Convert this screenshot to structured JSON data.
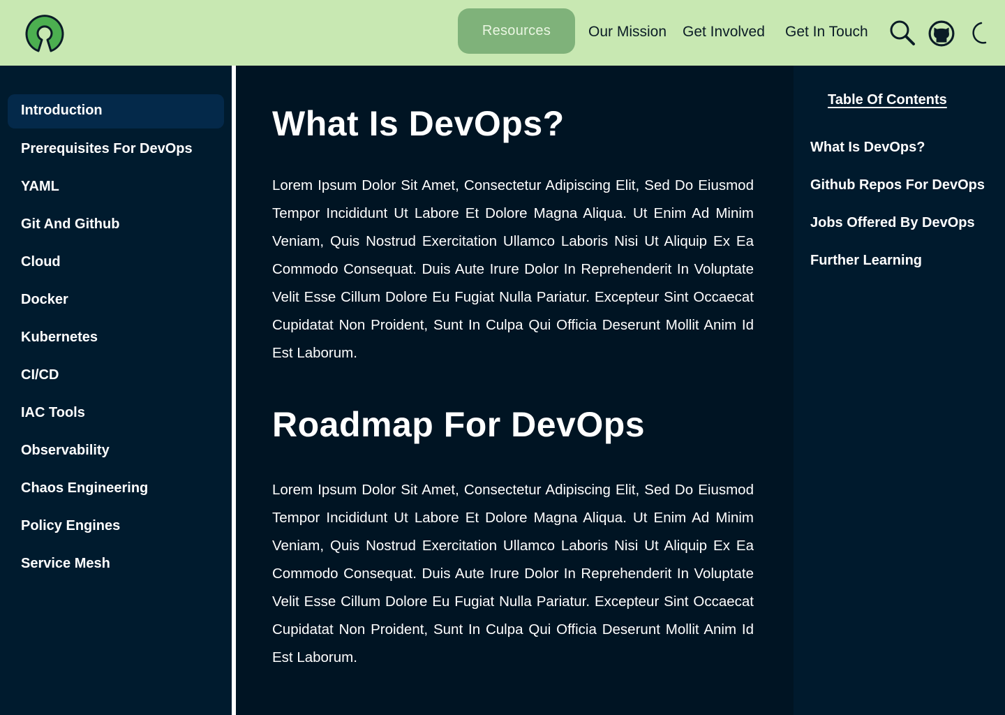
{
  "header": {
    "logo": "open-source-logo",
    "nav": {
      "resources": "Resources",
      "mission": "Our Mission",
      "involved": "Get Involved",
      "touch": "Get In Touch"
    },
    "icons": [
      "search-icon",
      "github-icon",
      "moon-icon"
    ],
    "colors": {
      "bar": "#c8e8b2",
      "active_pill": "#7fb27a"
    }
  },
  "sidebar": {
    "items": [
      "Introduction",
      "Prerequisites For DevOps",
      "YAML",
      "Git And Github",
      "Cloud",
      "Docker",
      "Kubernetes",
      "CI/CD",
      "IAC Tools",
      "Observability",
      "Chaos Engineering",
      "Policy Engines",
      "Service Mesh"
    ],
    "active": "Introduction"
  },
  "content": {
    "sections": [
      {
        "heading": "What Is DevOps?",
        "body": "Lorem Ipsum Dolor Sit Amet, Consectetur Adipiscing Elit, Sed Do Eiusmod Tempor Incididunt Ut Labore Et Dolore Magna Aliqua. Ut Enim Ad Minim Veniam, Quis Nostrud Exercitation Ullamco Laboris Nisi Ut Aliquip Ex Ea Commodo Consequat. Duis Aute Irure Dolor In Reprehenderit In Voluptate Velit Esse Cillum Dolore Eu Fugiat Nulla Pariatur. Excepteur Sint Occaecat Cupidatat Non Proident, Sunt In Culpa Qui Officia Deserunt Mollit Anim Id Est Laborum."
      },
      {
        "heading": "Roadmap For DevOps",
        "body": "Lorem Ipsum Dolor Sit Amet, Consectetur Adipiscing Elit, Sed Do Eiusmod Tempor Incididunt Ut Labore Et Dolore Magna Aliqua. Ut Enim Ad Minim Veniam, Quis Nostrud Exercitation Ullamco Laboris Nisi Ut Aliquip Ex Ea Commodo Consequat. Duis Aute Irure Dolor In Reprehenderit In Voluptate Velit Esse Cillum Dolore Eu Fugiat Nulla Pariatur. Excepteur Sint Occaecat Cupidatat Non Proident, Sunt In Culpa Qui Officia Deserunt Mollit Anim Id Est Laborum."
      }
    ]
  },
  "toc": {
    "title": "Table Of Contents",
    "items": [
      "What Is DevOps?",
      "Github Repos For DevOps",
      "Jobs Offered By DevOps",
      "Further Learning"
    ]
  }
}
